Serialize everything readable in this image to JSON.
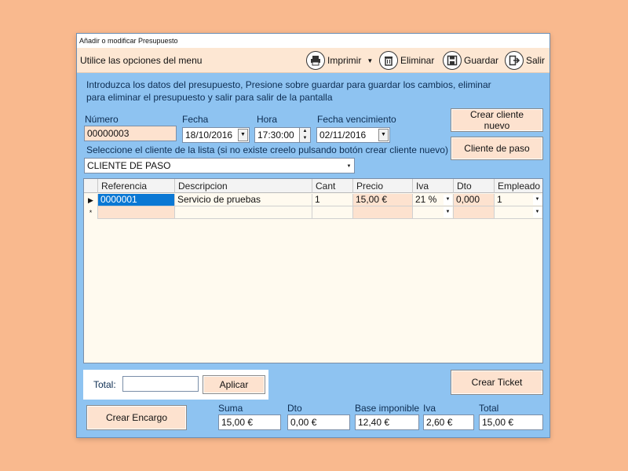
{
  "window": {
    "title": "Añadir o modificar Presupuesto"
  },
  "menu": {
    "caption": "Utilice las opciones del menu",
    "print_label": "Imprimir",
    "delete_label": "Eliminar",
    "save_label": "Guardar",
    "exit_label": "Salir"
  },
  "instructions": "Introduzca los datos del presupuesto, Presione sobre guardar para guardar los cambios, eliminar para eliminar el presupuesto y salir para salir de la pantalla",
  "form": {
    "numero_label": "Número",
    "numero_value": "00000003",
    "fecha_label": "Fecha",
    "fecha_value": "18/10/2016",
    "hora_label": "Hora",
    "hora_value": "17:30:00",
    "vencimiento_label": "Fecha vencimiento",
    "vencimiento_value": "02/11/2016",
    "cliente_prompt": "Seleccione el cliente de la lista (si no existe creelo pulsando botón crear cliente nuevo)",
    "cliente_value": "CLIENTE DE PASO"
  },
  "buttons": {
    "crear_cliente": "Crear cliente nuevo",
    "cliente_paso": "Cliente de paso",
    "aplicar": "Aplicar",
    "crear_ticket": "Crear Ticket",
    "crear_encargo": "Crear Encargo"
  },
  "grid": {
    "columns": [
      "Referencia",
      "Descripcion",
      "Cant",
      "Precio",
      "Iva",
      "Dto",
      "Empleado"
    ],
    "rows": [
      {
        "marker": "▶",
        "referencia": "0000001",
        "descripcion": "Servicio de pruebas",
        "cant": "1",
        "precio": "15,00 €",
        "iva": "21 %",
        "dto": "0,000",
        "empleado": "1"
      }
    ],
    "new_row_marker": "*"
  },
  "totals_input": {
    "label": "Total:",
    "value": ""
  },
  "summary": {
    "suma_label": "Suma",
    "suma_value": "15,00 €",
    "dto_label": "Dto",
    "dto_value": "0,00 €",
    "base_label": "Base imponible",
    "base_value": "12,40 €",
    "iva_label": "Iva",
    "iva_value": "2,60 €",
    "total_label": "Total",
    "total_value": "15,00 €"
  },
  "icons": {
    "print": "printer-icon",
    "delete": "trash-icon",
    "save": "floppy-disk-icon",
    "exit": "exit-icon"
  }
}
